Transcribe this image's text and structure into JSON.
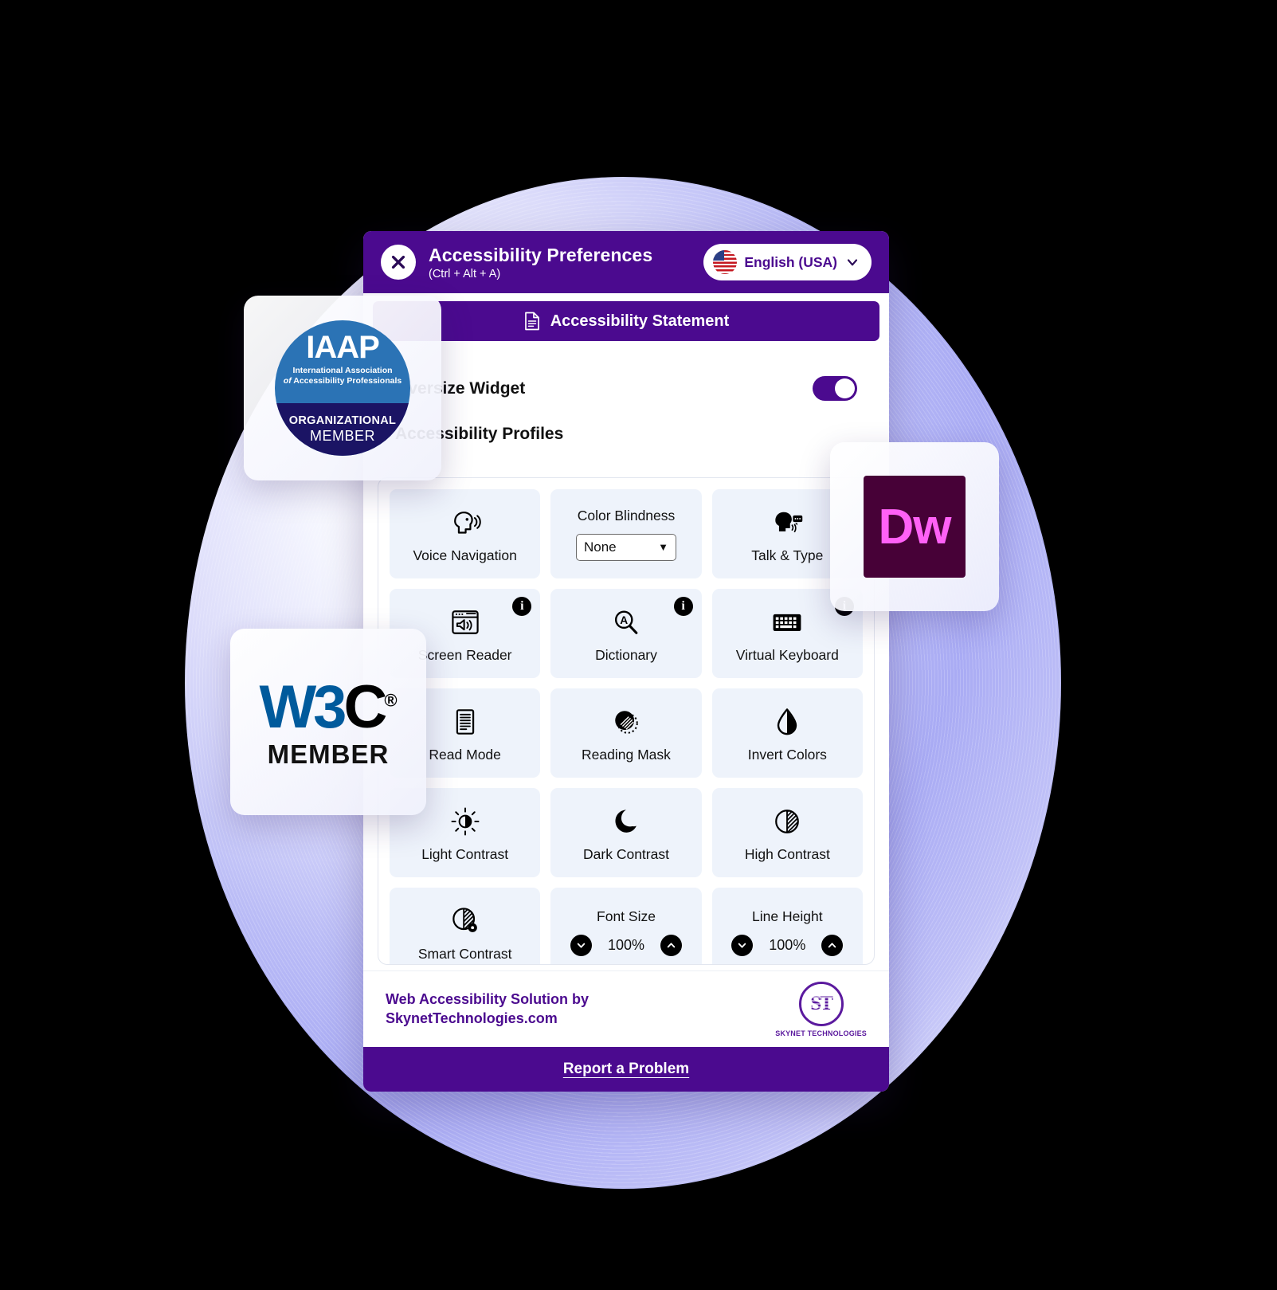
{
  "colors": {
    "brand_purple": "#4b0a8f",
    "tile_bg": "#eef3fb",
    "iaap_blue": "#2b73b5",
    "iaap_navy": "#1b1464",
    "w3c_blue": "#005a9c",
    "dw_bg": "#470137",
    "dw_fg": "#ff61f6"
  },
  "header": {
    "close_icon": "close-x-icon",
    "title": "Accessibility Preferences",
    "shortcut": "(Ctrl + Alt + A)",
    "language": {
      "flag_icon": "usa-flag-icon",
      "label": "English (USA)",
      "chevron_icon": "chevron-down-icon"
    }
  },
  "statement_bar": {
    "icon": "document-icon",
    "label": "Accessibility Statement"
  },
  "body": {
    "oversize_widget": {
      "label": "Oversize Widget",
      "toggle_state": "on"
    },
    "profiles_label": "Accessibility Profiles"
  },
  "tiles": [
    {
      "type": "icon",
      "icon": "voice-navigation-icon",
      "label": "Voice Navigation",
      "info": false
    },
    {
      "type": "select",
      "icon": "color-blindness-select",
      "label": "Color Blindness",
      "value": "None",
      "info": false
    },
    {
      "type": "icon",
      "icon": "talk-and-type-icon",
      "label": "Talk & Type",
      "info": false
    },
    {
      "type": "icon",
      "icon": "screen-reader-icon",
      "label": "Screen Reader",
      "info": true
    },
    {
      "type": "icon",
      "icon": "dictionary-icon",
      "label": "Dictionary",
      "info": true
    },
    {
      "type": "icon",
      "icon": "virtual-keyboard-icon",
      "label": "Virtual Keyboard",
      "info": true
    },
    {
      "type": "icon",
      "icon": "read-mode-icon",
      "label": "Read Mode",
      "info": false
    },
    {
      "type": "icon",
      "icon": "reading-mask-icon",
      "label": "Reading Mask",
      "info": false
    },
    {
      "type": "icon",
      "icon": "invert-colors-icon",
      "label": "Invert Colors",
      "info": false
    },
    {
      "type": "icon",
      "icon": "light-contrast-icon",
      "label": "Light Contrast",
      "info": false
    },
    {
      "type": "icon",
      "icon": "dark-contrast-icon",
      "label": "Dark Contrast",
      "info": false
    },
    {
      "type": "icon",
      "icon": "high-contrast-icon",
      "label": "High Contrast",
      "info": false
    },
    {
      "type": "icon",
      "icon": "smart-contrast-icon",
      "label": "Smart Contrast",
      "info": false
    },
    {
      "type": "stepper",
      "label": "Font Size",
      "value": "100%",
      "dec_icon": "chevron-down-circle-icon",
      "inc_icon": "chevron-up-circle-icon"
    },
    {
      "type": "stepper",
      "label": "Line Height",
      "value": "100%",
      "dec_icon": "chevron-down-circle-icon",
      "inc_icon": "chevron-up-circle-icon"
    }
  ],
  "footer": {
    "line1": "Web Accessibility Solution by",
    "line2": "SkynetTechnologies.com",
    "logo_mark": "ST",
    "logo_caption": "SKYNET TECHNOLOGIES"
  },
  "report_bar": {
    "label": "Report a Problem"
  },
  "badges": {
    "iaap": {
      "acronym": "IAAP",
      "line1": "International Association",
      "line2_italic": "of",
      "line2": "Accessibility Professionals",
      "band_line1": "ORGANIZATIONAL",
      "band_line2": "MEMBER"
    },
    "w3c": {
      "logo_w3": "W3",
      "logo_c": "C",
      "registered": "®",
      "member": "MEMBER"
    },
    "dreamweaver": {
      "label": "Dw"
    }
  }
}
